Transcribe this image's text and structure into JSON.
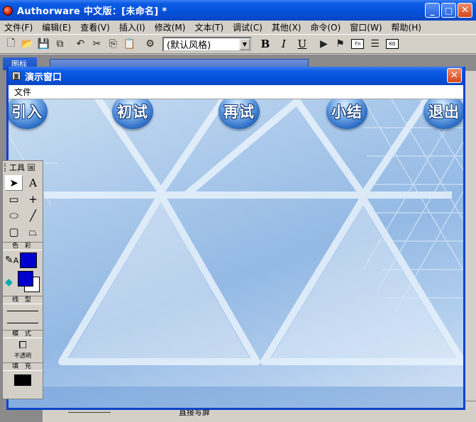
{
  "app": {
    "title": "Authorware 中文版：[未命名] *"
  },
  "window_buttons": {
    "minimize": "_",
    "maximize": "□",
    "close": "✕"
  },
  "menubar": [
    "文件(F)",
    "编辑(E)",
    "查看(V)",
    "插入(I)",
    "修改(M)",
    "文本(T)",
    "调试(C)",
    "其他(X)",
    "命令(O)",
    "窗口(W)",
    "帮助(H)"
  ],
  "toolbar": {
    "style_select": {
      "value": "(默认风格)",
      "arrow": "▼"
    },
    "bold": "B",
    "italic": "I",
    "underline": "U",
    "functions_label": "fn",
    "ko_label": "KO"
  },
  "background": {
    "icons_window_title": "图标",
    "bottom_text": "直接写屏"
  },
  "presentation": {
    "title": "演示窗口",
    "close": "✕",
    "menu": [
      "文件"
    ],
    "nav_buttons": [
      "引入",
      "初试",
      "再试",
      "小结",
      "退出"
    ]
  },
  "tools_palette": {
    "title": "工具",
    "close": "⊠",
    "colors_label": "色 彩",
    "line_label": "线 型",
    "mode_label": "模 式",
    "mode_value": "不透明",
    "fill_label": "填 充",
    "foreground_color": "#0000cc",
    "background_color": "#ffffff",
    "fill_color": "#000000"
  }
}
